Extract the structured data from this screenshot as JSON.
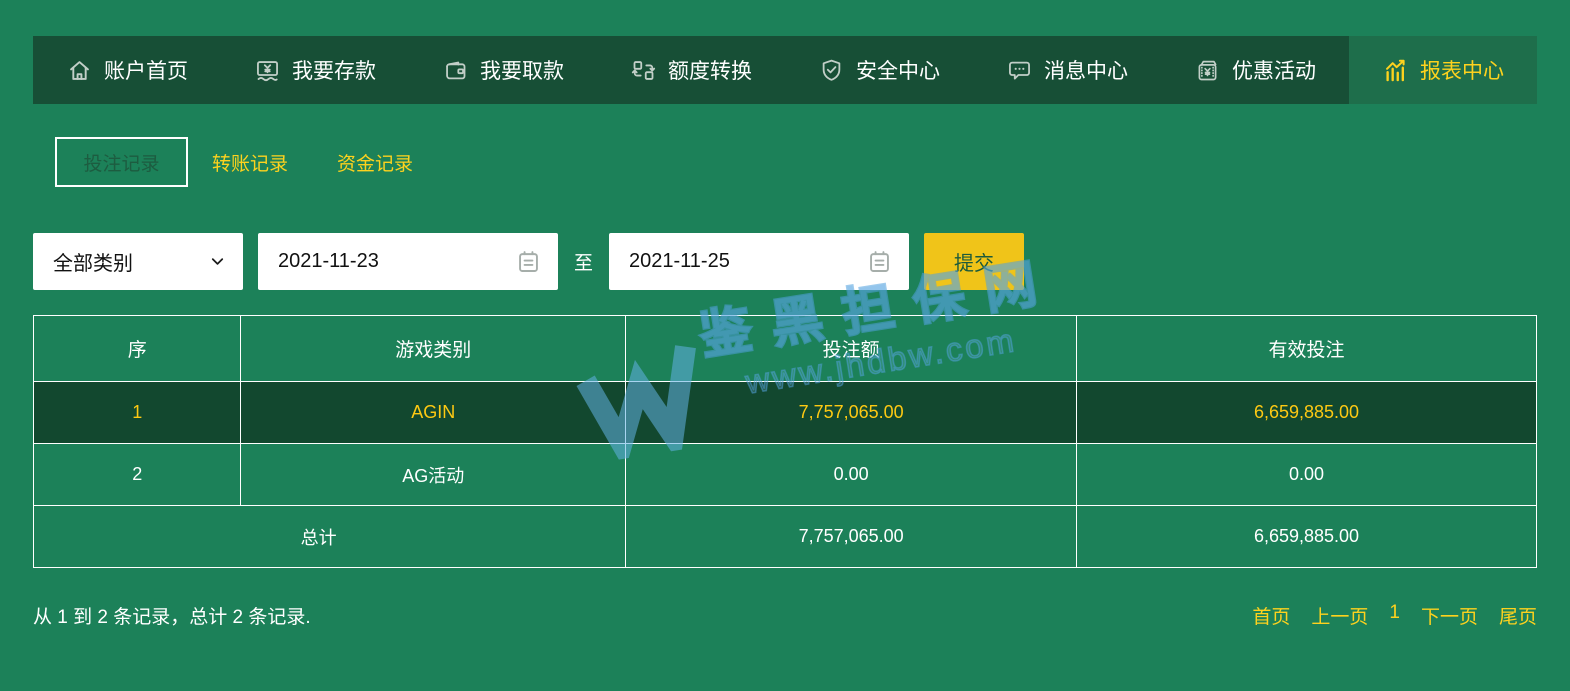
{
  "colors": {
    "page_bg": "#1c8159",
    "nav_bg": "#174f36",
    "nav_active_bg": "#1e6e4b",
    "accent_yellow": "#fdd21e",
    "table_value_yellow": "#fdc913",
    "button_yellow": "#f0c419",
    "row_highlight_bg": "#12482f",
    "watermark_blue": "#4aa3df"
  },
  "nav": {
    "items": [
      {
        "label": "账户首页",
        "icon": "home-icon",
        "active": false
      },
      {
        "label": "我要存款",
        "icon": "deposit-icon",
        "active": false
      },
      {
        "label": "我要取款",
        "icon": "withdraw-wallet-icon",
        "active": false
      },
      {
        "label": "额度转换",
        "icon": "transfer-icon",
        "active": false
      },
      {
        "label": "安全中心",
        "icon": "shield-check-icon",
        "active": false
      },
      {
        "label": "消息中心",
        "icon": "message-icon",
        "active": false
      },
      {
        "label": "优惠活动",
        "icon": "promo-packet-icon",
        "active": false
      },
      {
        "label": "报表中心",
        "icon": "report-chart-icon",
        "active": true
      }
    ]
  },
  "tabs": {
    "items": [
      {
        "label": "投注记录",
        "active": true
      },
      {
        "label": "转账记录",
        "active": false
      },
      {
        "label": "资金记录",
        "active": false
      }
    ]
  },
  "filters": {
    "category_select": {
      "value": "全部类别"
    },
    "date_from": {
      "value": "2021-11-23"
    },
    "to_label": "至",
    "date_to": {
      "value": "2021-11-25"
    },
    "submit_label": "提交"
  },
  "table": {
    "headers": [
      "序",
      "游戏类别",
      "投注额",
      "有效投注"
    ],
    "rows": [
      {
        "no": "1",
        "game": "AGIN",
        "bet_amount": "7,757,065.00",
        "valid_bet": "6,659,885.00",
        "highlighted": true
      },
      {
        "no": "2",
        "game": "AG活动",
        "bet_amount": "0.00",
        "valid_bet": "0.00",
        "highlighted": false
      }
    ],
    "total": {
      "label": "总计",
      "bet_amount": "7,757,065.00",
      "valid_bet": "6,659,885.00"
    }
  },
  "footer": {
    "summary": "从 1 到 2 条记录，总计 2 条记录.",
    "pagination": [
      {
        "label": "首页"
      },
      {
        "label": "上一页"
      },
      {
        "label": "1"
      },
      {
        "label": "下一页"
      },
      {
        "label": "尾页"
      }
    ]
  },
  "watermark": {
    "brand": "鉴黑担保网",
    "url": "www.jhdbw.com"
  }
}
